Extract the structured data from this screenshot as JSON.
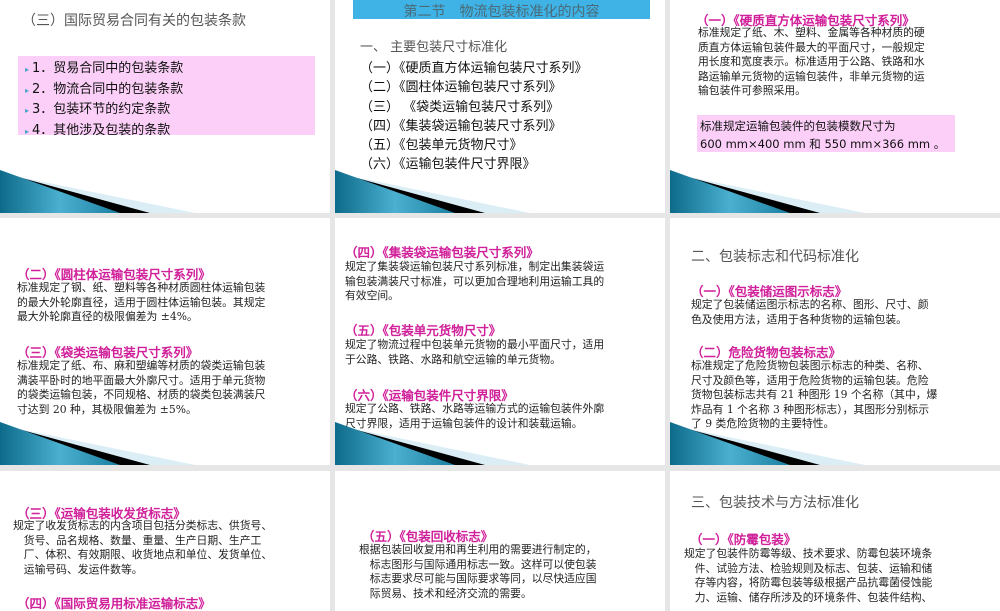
{
  "slides": {
    "s1": {
      "title": "（三）国际贸易合同有关的包装条款",
      "items": [
        "1．贸易合同中的包装条款",
        "2．物流合同中的包装条款",
        "3．包装环节的约定条款",
        "4．其他涉及包装的条款"
      ]
    },
    "s2": {
      "header": "第二节　物流包装标准化的内容",
      "section": "一、 主要包装尺寸标准化",
      "items": [
        "（一）《硬质直方体运输包装尺寸系列》",
        "（二）《圆柱体运输包装尺寸系列》",
        "（三） 《袋类运输包装尺寸系列》",
        "（四）《集装袋运输包装尺寸系列》",
        "（五）《包装单元货物尺寸》",
        "（六）《运输包装件尺寸界限》"
      ]
    },
    "s3": {
      "heading": "（一）《硬质直方体运输包装尺寸系列》",
      "body": [
        "标准规定了纸、木、塑料、金属等各种材质的硬",
        "质直方体运输包装件最大的平面尺寸，一般规定",
        "用长度和宽度表示。标准适用于公路、铁路和水",
        "路运输单元货物的运输包装件，非单元货物的运",
        "输包装件可参照采用。"
      ],
      "box": [
        "标准规定运输包装件的包装模数尺寸为",
        "600 mm×400 mm 和 550 mm×366 mm 。"
      ]
    },
    "s4": {
      "heading1": "（二）《圆柱体运输包装尺寸系列》",
      "body1": [
        "标准规定了钢、纸、塑料等各种材质圆柱体运输包装",
        "的最大外轮廓直径，适用于圆柱体运输包装。其规定",
        "最大外轮廓直径的极限偏差为 ±4%。"
      ],
      "heading2": "（三）《袋类运输包装尺寸系列》",
      "body2": [
        "标准规定了纸、布、麻和塑编等材质的袋类运输包装",
        "满装平卧时的地平面最大外廓尺寸。适用于单元货物",
        "的袋类运输包装，不同规格、材质的袋类包装满装尺",
        "寸达到 20 种，其极限偏差为 ±5%。"
      ]
    },
    "s5": {
      "heading1": "（四）《集装袋运输包装尺寸系列》",
      "body1": [
        "规定了集装袋运输包装尺寸系列标准，制定出集装袋运",
        "输包装满装尺寸标准，可以更加合理地利用运输工具的",
        "有效空间。"
      ],
      "heading2": "（五）《包装单元货物尺寸》",
      "body2": [
        "规定了物流过程中包装单元货物的最小平面尺寸，适用",
        "于公路、铁路、水路和航空运输的单元货物。"
      ],
      "heading3": "（六）《运输包装件尺寸界限》",
      "body3": [
        "规定了公路、铁路、水路等运输方式的运输包装件外廓",
        "尺寸界限，适用于运输包装件的设计和装载运输。"
      ]
    },
    "s6": {
      "title": "二、包装标志和代码标准化",
      "heading1": "（一）《包装储运图示标志》",
      "body1": [
        "规定了包装储运图示标志的名称、图形、尺寸、颜",
        "色及使用方法，适用于各种货物的运输包装。"
      ],
      "heading2": "（二）危险货物包装标志》",
      "body2": [
        "标准规定了危险货物包装图示标志的种类、名称、",
        "尺寸及颜色等，适用于危险货物的运输包装。危险",
        "货物包装标志共有 21 种图形 19 个名称（其中，爆",
        "炸品有 1 个名称 3 种图形标志），其图形分别标示",
        "了 9 类危险货物的主要特性。"
      ]
    },
    "s7": {
      "heading1": "（三）《运输包装收发货标志》",
      "body1": [
        "规定了收发货标志的内含项目包括分类标志、供货号、",
        "　货号、品名规格、数量、重量、生产日期、生产工",
        "　厂、体积、有效期限、收货地点和单位、发货单位、",
        "　运输号码、发运件数等。"
      ],
      "heading2": "（四）《国际贸易用标准运输标志》"
    },
    "s8": {
      "heading1": "（五）《包装回收标志》",
      "body1": [
        "根据包装回收复用和再生利用的需要进行制定的，",
        "　标志图形与国际通用标志一致。这样可以使包装",
        "　标志要求尽可能与国际要求等同，以尽快适应国",
        "　际贸易、技术和经济交流的需要。"
      ]
    },
    "s9": {
      "title": "三、包装技术与方法标准化",
      "heading1": "（一）《防霉包装》",
      "body1": [
        "规定了包装件防霉等级、技术要求、防霉包装环境条",
        "　件、试验方法、检验规则及标志、包装、运输和储",
        "　存等内容，将防霉包装等级根据产品抗霉菌侵蚀能",
        "　力、运输、储存所涉及的环境条件、包装件结构、"
      ]
    }
  },
  "colors": {
    "accent_pink": "#d0209a",
    "box_pink": "#fbcff8",
    "header_blue": "#3fb3e6",
    "swoosh_teal": "#1a7fa0"
  }
}
